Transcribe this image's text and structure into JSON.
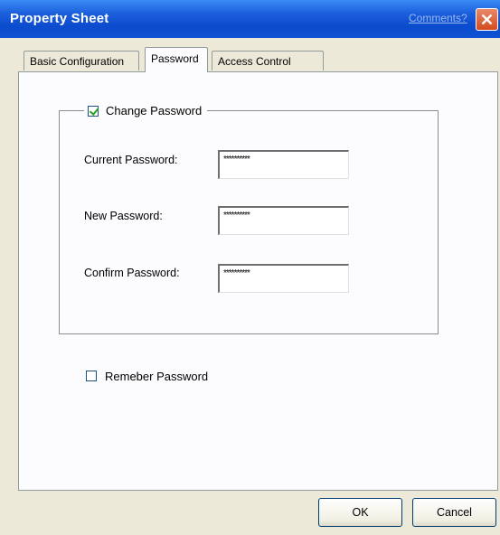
{
  "window": {
    "title": "Property Sheet",
    "comments_link": "Comments?"
  },
  "tabs": [
    {
      "label": "Basic Configuration",
      "active": false
    },
    {
      "label": "Password",
      "active": true
    },
    {
      "label": "Access Control",
      "active": false
    }
  ],
  "password": {
    "change_label": "Change Password",
    "change_checked": true,
    "current_label": "Current Password:",
    "current_value": "**********",
    "new_label": "New Password:",
    "new_value": "**********",
    "confirm_label": "Confirm Password:",
    "confirm_value": "**********",
    "remember_label": "Remeber Password",
    "remember_checked": false
  },
  "buttons": {
    "ok": "OK",
    "cancel": "Cancel"
  },
  "icons": {
    "close": "close-icon",
    "check": "checkmark-icon"
  },
  "colors": {
    "titlebar": "#0b4bcd",
    "close": "#d44a1d",
    "face": "#ece9d8"
  }
}
